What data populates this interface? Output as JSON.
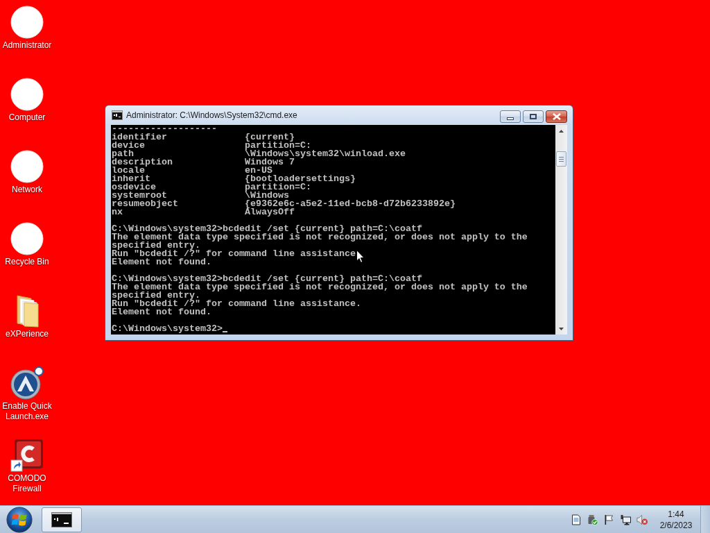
{
  "desktop": {
    "icons": [
      {
        "label": "Administrator",
        "kind": "disc"
      },
      {
        "label": "Computer",
        "kind": "disc"
      },
      {
        "label": "Network",
        "kind": "disc"
      },
      {
        "label": "Recycle Bin",
        "kind": "disc"
      },
      {
        "label": "eXPerience",
        "kind": "folder"
      },
      {
        "label": "Enable Quick Launch.exe",
        "kind": "app"
      },
      {
        "label": "COMODO Firewall",
        "kind": "shortcut"
      }
    ]
  },
  "window": {
    "title": "Administrator: C:\\Windows\\System32\\cmd.exe",
    "lines": [
      {
        "kind": "text",
        "text": "-------------------"
      },
      {
        "kind": "pair",
        "name": "identifier",
        "value": "{current}"
      },
      {
        "kind": "pair",
        "name": "device",
        "value": "partition=C:"
      },
      {
        "kind": "pair",
        "name": "path",
        "value": "\\Windows\\system32\\winload.exe"
      },
      {
        "kind": "pair",
        "name": "description",
        "value": "Windows 7"
      },
      {
        "kind": "pair",
        "name": "locale",
        "value": "en-US"
      },
      {
        "kind": "pair",
        "name": "inherit",
        "value": "{bootloadersettings}"
      },
      {
        "kind": "pair",
        "name": "osdevice",
        "value": "partition=C:"
      },
      {
        "kind": "pair",
        "name": "systemroot",
        "value": "\\Windows"
      },
      {
        "kind": "pair",
        "name": "resumeobject",
        "value": "{e9362e6c-a5e2-11ed-bcb8-d72b6233892e}"
      },
      {
        "kind": "pair",
        "name": "nx",
        "value": "AlwaysOff"
      },
      {
        "kind": "blank"
      },
      {
        "kind": "text",
        "text": "C:\\Windows\\system32>bcdedit /set {current} path=C:\\coatf"
      },
      {
        "kind": "text",
        "text": "The element data type specified is not recognized, or does not apply to the"
      },
      {
        "kind": "text",
        "text": "specified entry."
      },
      {
        "kind": "text",
        "text": "Run \"bcdedit /?\" for command line assistance"
      },
      {
        "kind": "text",
        "text": "Element not found."
      },
      {
        "kind": "blank"
      },
      {
        "kind": "text",
        "text": "C:\\Windows\\system32>bcdedit /set {current} path=C:\\coatf"
      },
      {
        "kind": "text",
        "text": "The element data type specified is not recognized, or does not apply to the"
      },
      {
        "kind": "text",
        "text": "specified entry."
      },
      {
        "kind": "text",
        "text": "Run \"bcdedit /?\" for command line assistance."
      },
      {
        "kind": "text",
        "text": "Element not found."
      },
      {
        "kind": "blank"
      },
      {
        "kind": "prompt",
        "text": "C:\\Windows\\system32>"
      }
    ]
  },
  "taskbar": {
    "clock": {
      "time": "1:44",
      "date": "2/6/2023"
    }
  }
}
